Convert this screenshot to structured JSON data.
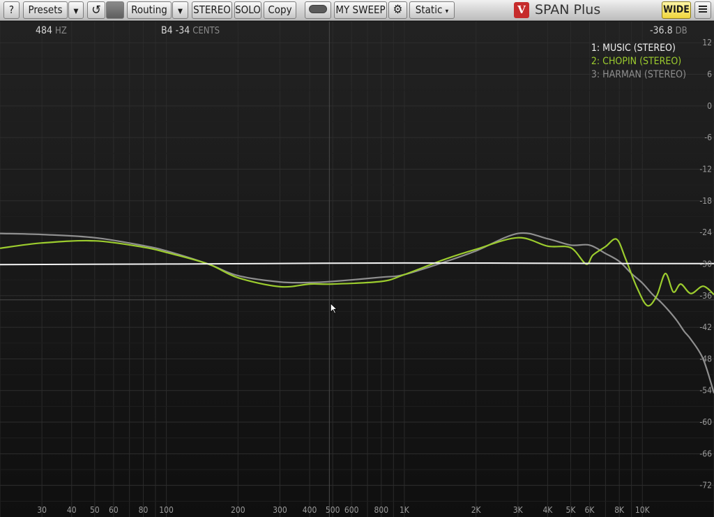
{
  "toolbar": {
    "help_label": "?",
    "presets_label": "Presets",
    "presets_arrow": "▼",
    "undo_icon": "↺",
    "routing_label": "Routing",
    "routing_arrow": "▼",
    "stereo_label": "STEREO",
    "solo_label": "SOLO",
    "copy_label": "Copy",
    "sweep_label": "MY SWEEP",
    "mode_label": "Static",
    "mode_arrow": "▾",
    "wide_label": "WIDE",
    "settings_icon": "⚙"
  },
  "logo": {
    "mark": "V",
    "name": "SPAN Plus"
  },
  "readout": {
    "freq_value": "484",
    "freq_unit": "HZ",
    "note_value": "B4 -34",
    "note_unit": "CENTS",
    "level_value": "-36.8",
    "level_unit": "DB"
  },
  "legend": [
    {
      "label": "1: MUSIC (STEREO)",
      "color": "#f2f2f2"
    },
    {
      "label": "2: CHOPIN (STEREO)",
      "color": "#9ccc2e"
    },
    {
      "label": "3: HARMAN (STEREO)",
      "color": "#8f8f8f"
    }
  ],
  "chart_data": {
    "type": "line",
    "x_scale": "log",
    "xlim": [
      20,
      20000
    ],
    "ylim": [
      -78,
      16
    ],
    "x_tick_labels": [
      {
        "label": "30",
        "value": 30
      },
      {
        "label": "40",
        "value": 40
      },
      {
        "label": "50",
        "value": 50
      },
      {
        "label": "60",
        "value": 60
      },
      {
        "label": "80",
        "value": 80
      },
      {
        "label": "100",
        "value": 100
      },
      {
        "label": "200",
        "value": 200
      },
      {
        "label": "300",
        "value": 300
      },
      {
        "label": "400",
        "value": 400
      },
      {
        "label": "500",
        "value": 500
      },
      {
        "label": "600",
        "value": 600
      },
      {
        "label": "800",
        "value": 800
      },
      {
        "label": "1K",
        "value": 1000
      },
      {
        "label": "2K",
        "value": 2000
      },
      {
        "label": "3K",
        "value": 3000
      },
      {
        "label": "4K",
        "value": 4000
      },
      {
        "label": "5K",
        "value": 5000
      },
      {
        "label": "6K",
        "value": 6000
      },
      {
        "label": "8K",
        "value": 8000
      },
      {
        "label": "10K",
        "value": 10000
      }
    ],
    "y_ticks": [
      12,
      6,
      0,
      -6,
      -12,
      -18,
      -24,
      -30,
      -36,
      -42,
      -48,
      -54,
      -60,
      -66,
      -72
    ],
    "y_tick_labels": [
      "12",
      "6",
      "0",
      "-6",
      "-12",
      "-18",
      "-24",
      "-30",
      "-36",
      "-42",
      "-48",
      "-54",
      "-60",
      "-66",
      "-72"
    ],
    "cursor": {
      "freq": 484,
      "level": -36.8
    },
    "series": [
      {
        "name": "1: MUSIC (STEREO)",
        "color": "#f2f2f2",
        "x": [
          20,
          100,
          1000,
          10000,
          20000
        ],
        "y": [
          -30.1,
          -30.0,
          -29.8,
          -29.9,
          -29.9
        ]
      },
      {
        "name": "2: CHOPIN (STEREO)",
        "color": "#9ccc2e",
        "x": [
          20,
          30,
          50,
          80,
          100,
          150,
          200,
          300,
          400,
          500,
          800,
          1000,
          1500,
          2000,
          3000,
          4000,
          5000,
          5800,
          6200,
          7000,
          7800,
          8500,
          9500,
          10500,
          11500,
          12500,
          13500,
          14500,
          16000,
          18000,
          20000
        ],
        "y": [
          -27,
          -26,
          -25.6,
          -26.8,
          -27.8,
          -30,
          -32.6,
          -34.3,
          -33.8,
          -33.8,
          -33.3,
          -32,
          -29,
          -27.2,
          -25,
          -26.6,
          -26.9,
          -30,
          -28.3,
          -26.7,
          -25.3,
          -29,
          -34.5,
          -37.9,
          -36,
          -31.8,
          -35.3,
          -33.8,
          -35.6,
          -34.2,
          -35.8
        ]
      },
      {
        "name": "3: HARMAN (STEREO)",
        "color": "#8f8f8f",
        "x": [
          20,
          30,
          50,
          80,
          100,
          150,
          200,
          300,
          400,
          500,
          800,
          1000,
          1500,
          2000,
          3000,
          4000,
          5000,
          6000,
          7000,
          8000,
          9000,
          10000,
          11000,
          12000,
          13000,
          14000,
          15000,
          16000,
          18000,
          20000
        ],
        "y": [
          -24.2,
          -24.4,
          -25,
          -26.5,
          -27.5,
          -30,
          -32.2,
          -33.4,
          -33.5,
          -33.3,
          -32.5,
          -32,
          -29.5,
          -27.5,
          -24.2,
          -25.2,
          -26.4,
          -26.4,
          -28,
          -29.5,
          -31.8,
          -33.6,
          -35.7,
          -37.3,
          -39,
          -40.8,
          -42.8,
          -44.3,
          -48,
          -54.5
        ]
      }
    ]
  }
}
